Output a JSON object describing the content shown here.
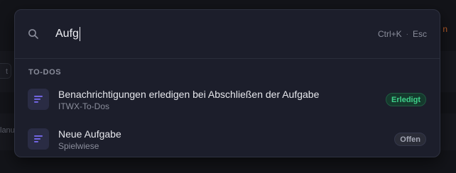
{
  "background": {
    "left_chip_text": "t",
    "left_text": "lanu",
    "right_text": "n"
  },
  "search": {
    "value": "Aufg",
    "shortcut": "Ctrl+K",
    "separator": "·",
    "escape": "Esc"
  },
  "section": {
    "heading": "TO-DOS"
  },
  "results": [
    {
      "title": "Benachrichtigungen erledigen bei Abschließen der Aufgabe",
      "subtitle": "ITWX-To-Dos",
      "status": "Erledigt",
      "status_color": "#3ed08a",
      "icon": "list-lines-icon"
    },
    {
      "title": "Neue Aufgabe",
      "subtitle": "Spielwiese",
      "status": "Offen",
      "status_color": "#a3a6b3",
      "icon": "list-lines-icon"
    }
  ],
  "colors": {
    "accent": "#7b6cf6",
    "palette_bg": "#1c1e2b",
    "page_bg": "#131419"
  }
}
